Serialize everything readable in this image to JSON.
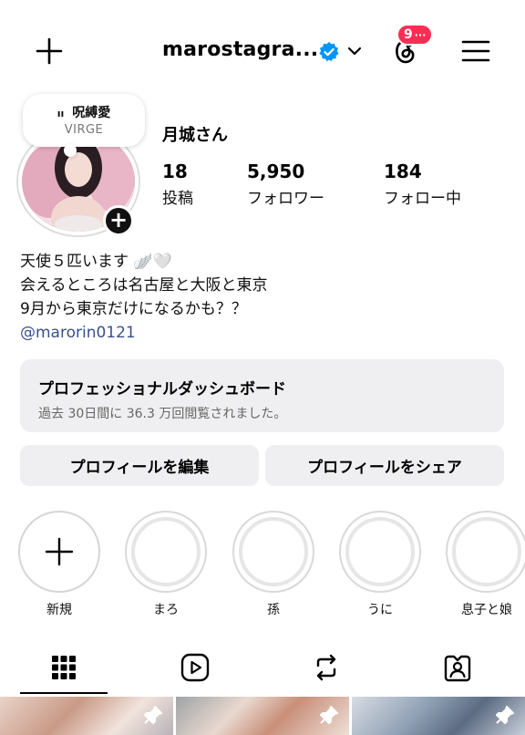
{
  "header": {
    "username": "marostagra...",
    "notification_count": "9",
    "notification_more": "···",
    "icons": [
      "plus-icon",
      "verified-icon",
      "chevron-down-icon",
      "threads-icon",
      "menu-icon"
    ]
  },
  "note": {
    "title": "呪縛愛",
    "subtitle": "VIRGE"
  },
  "profile": {
    "display_name": "月城さん",
    "stats": [
      {
        "value": "18",
        "label": "投稿"
      },
      {
        "value": "5,950",
        "label": "フォロワー"
      },
      {
        "value": "184",
        "label": "フォロー中"
      }
    ]
  },
  "bio": {
    "line1": "天使５匹います",
    "line1_emoji": "🪽🤍",
    "line2": "会えるところは名古屋と大阪と東京",
    "line3": "9月から東京だけになるかも？？",
    "link": "@marorin0121"
  },
  "dashboard": {
    "title": "プロフェッショナルダッシュボード",
    "subtitle": "過去 30日間に 36.3 万回閲覧されました。"
  },
  "buttons": {
    "edit": "プロフィールを編集",
    "share": "プロフィールをシェア"
  },
  "highlights": [
    {
      "label": "新規"
    },
    {
      "label": "まろ"
    },
    {
      "label": "孫"
    },
    {
      "label": "うに"
    },
    {
      "label": "息子と娘"
    }
  ],
  "tabs": [
    "grid-icon",
    "reels-icon",
    "reposts-icon",
    "tagged-icon"
  ],
  "colors": {
    "badge": "#ff2d55",
    "verified": "#0095f6",
    "link": "#3a4f8e",
    "surface": "#efeff1"
  }
}
